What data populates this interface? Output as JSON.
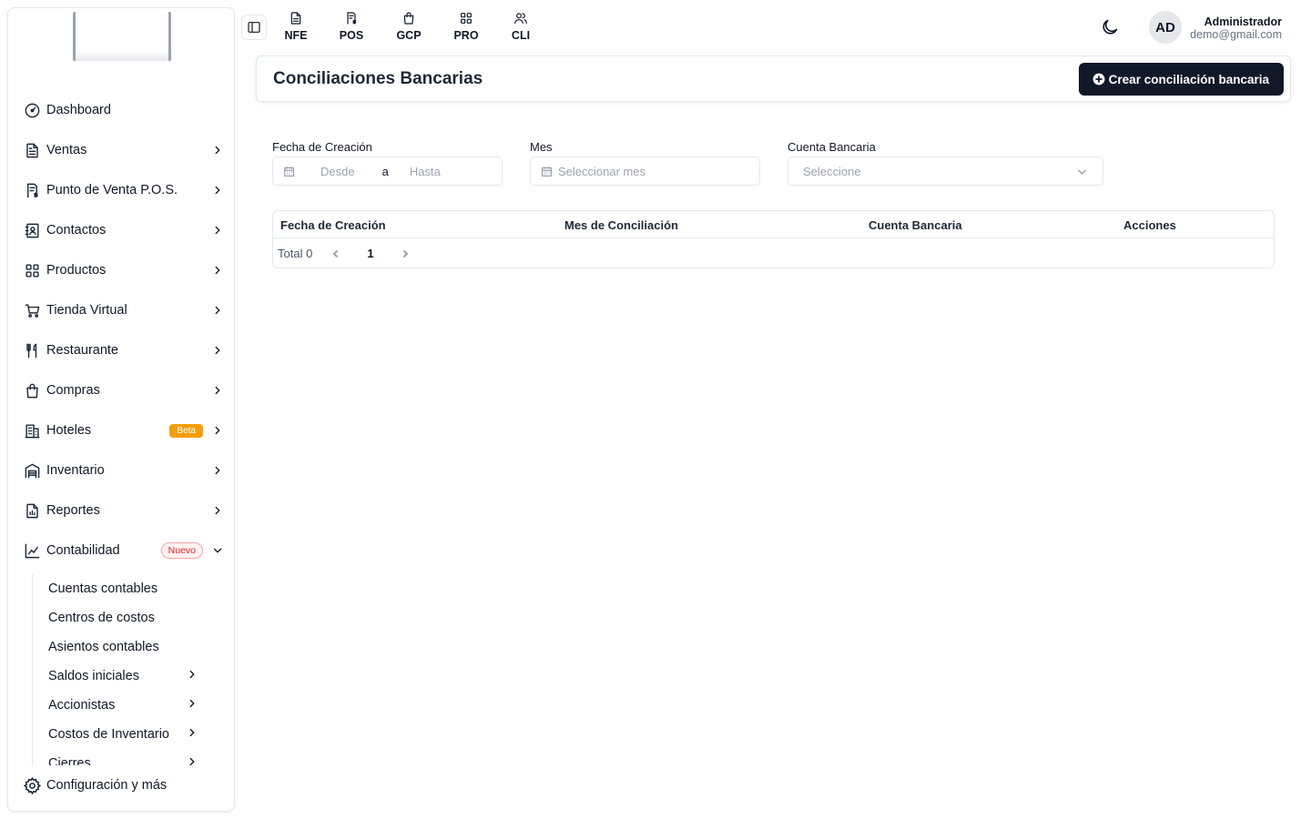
{
  "sidebar": {
    "items": [
      {
        "label": "Dashboard",
        "icon": "dashboard-gauge-icon",
        "chevron": false
      },
      {
        "label": "Ventas",
        "icon": "document-icon",
        "chevron": true
      },
      {
        "label": "Punto de Venta P.O.S.",
        "icon": "pos-receipt-icon",
        "chevron": true
      },
      {
        "label": "Contactos",
        "icon": "contacts-book-icon",
        "chevron": true
      },
      {
        "label": "Productos",
        "icon": "grid-products-icon",
        "chevron": true
      },
      {
        "label": "Tienda Virtual",
        "icon": "cart-icon",
        "chevron": true
      },
      {
        "label": "Restaurante",
        "icon": "utensils-icon",
        "chevron": true
      },
      {
        "label": "Compras",
        "icon": "shopping-bag-icon",
        "chevron": true
      },
      {
        "label": "Hoteles",
        "icon": "hotel-building-icon",
        "chevron": true,
        "badge": "Beta"
      },
      {
        "label": "Inventario",
        "icon": "warehouse-icon",
        "chevron": true
      },
      {
        "label": "Reportes",
        "icon": "report-chart-icon",
        "chevron": true
      },
      {
        "label": "Contabilidad",
        "icon": "accounting-chart-icon",
        "chevron": "down",
        "badge": "Nuevo"
      }
    ],
    "sub_items": [
      {
        "label": "Cuentas contables",
        "chevron": false
      },
      {
        "label": "Centros de costos",
        "chevron": false
      },
      {
        "label": "Asientos contables",
        "chevron": false
      },
      {
        "label": "Saldos iniciales",
        "chevron": true
      },
      {
        "label": "Accionistas",
        "chevron": true
      },
      {
        "label": "Costos de Inventario",
        "chevron": true
      },
      {
        "label": "Cierres",
        "chevron": true
      }
    ],
    "config_label": "Configuración y más"
  },
  "topbar": {
    "modules": [
      {
        "label": "NFE",
        "icon": "file-text-icon"
      },
      {
        "label": "POS",
        "icon": "receipt-dollar-icon"
      },
      {
        "label": "GCP",
        "icon": "shopping-bag-icon"
      },
      {
        "label": "PRO",
        "icon": "grid-icon"
      },
      {
        "label": "CLI",
        "icon": "users-icon"
      }
    ],
    "theme_icon": "moon-icon",
    "user": {
      "initials": "AD",
      "name": "Administrador",
      "email": "demo@gmail.com"
    }
  },
  "header": {
    "title": "Conciliaciones Bancarias",
    "create_label": "Crear conciliación bancaria"
  },
  "filters": {
    "date_label": "Fecha de Creación",
    "date_from_placeholder": "Desde",
    "date_sep": "a",
    "date_to_placeholder": "Hasta",
    "month_label": "Mes",
    "month_placeholder": "Seleccionar mes",
    "account_label": "Cuenta Bancaria",
    "account_placeholder": "Seleccione"
  },
  "table": {
    "columns": [
      "Fecha de Creación",
      "Mes de Conciliación",
      "Cuenta Bancaria",
      "Acciones"
    ],
    "rows": [],
    "total_label": "Total 0",
    "current_page": "1"
  },
  "colors": {
    "primary_button": "#111827",
    "beta_badge": "#f59e0b",
    "new_badge": "#dc2626"
  }
}
